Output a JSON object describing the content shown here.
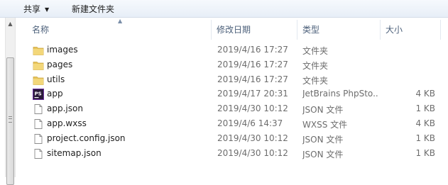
{
  "toolbar": {
    "share_label": "共享",
    "share_caret": "▼",
    "new_folder_label": "新建文件夹"
  },
  "columns": {
    "name": "名称",
    "modified": "修改日期",
    "type": "类型",
    "size": "大小"
  },
  "files": [
    {
      "name": "images",
      "modified": "2019/4/16 17:27",
      "type": "文件夹",
      "size": "",
      "icon": "folder-icon"
    },
    {
      "name": "pages",
      "modified": "2019/4/16 17:27",
      "type": "文件夹",
      "size": "",
      "icon": "folder-icon"
    },
    {
      "name": "utils",
      "modified": "2019/4/16 17:27",
      "type": "文件夹",
      "size": "",
      "icon": "folder-icon"
    },
    {
      "name": "app",
      "modified": "2019/4/17 20:31",
      "type": "JetBrains PhpSto...",
      "size": "4 KB",
      "icon": "phpstorm-icon"
    },
    {
      "name": "app.json",
      "modified": "2019/4/30 10:12",
      "type": "JSON 文件",
      "size": "1 KB",
      "icon": "document-icon"
    },
    {
      "name": "app.wxss",
      "modified": "2019/4/6 14:37",
      "type": "WXSS 文件",
      "size": "4 KB",
      "icon": "document-icon"
    },
    {
      "name": "project.config.json",
      "modified": "2019/4/30 10:12",
      "type": "JSON 文件",
      "size": "1 KB",
      "icon": "document-icon"
    },
    {
      "name": "sitemap.json",
      "modified": "2019/4/30 10:12",
      "type": "JSON 文件",
      "size": "1 KB",
      "icon": "document-icon"
    }
  ],
  "colors": {
    "folder": "#e8c45a",
    "phpstorm": "#6b2fa0",
    "header_text": "#4c607a",
    "meta_text": "#6d6d6d"
  }
}
